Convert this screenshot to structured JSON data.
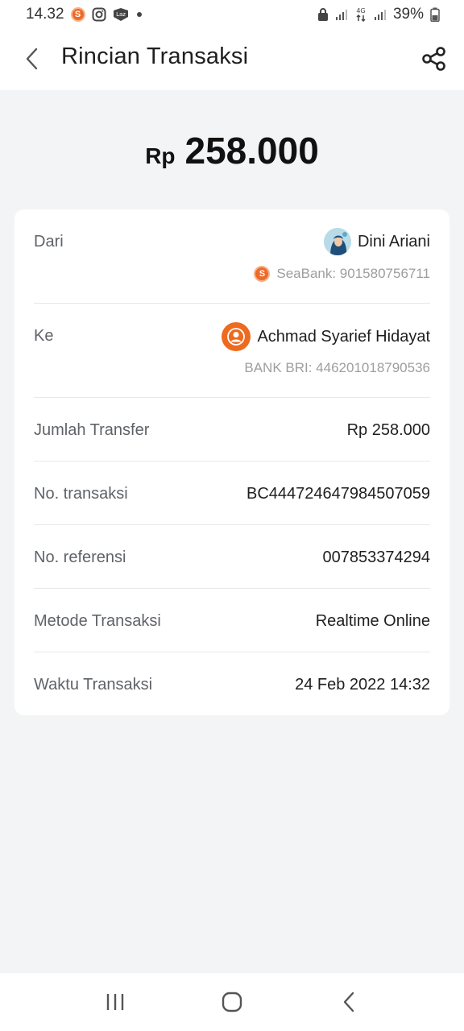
{
  "status_bar": {
    "time": "14.32",
    "battery": "39%",
    "network": "4G",
    "icons": [
      "seabank-icon",
      "instagram-icon",
      "lazada-icon",
      "dot-icon",
      "lock-icon",
      "signal-icon",
      "signal-4g-icon",
      "signal-icon",
      "battery-icon"
    ]
  },
  "header": {
    "title": "Rincian Transaksi",
    "back_icon": "chevron-left-icon",
    "share_icon": "share-icon"
  },
  "amount": {
    "currency": "Rp",
    "value": "258.000"
  },
  "details": {
    "from": {
      "label": "Dari",
      "name": "Dini Ariani",
      "account": "SeaBank: 901580756711",
      "avatar": "user-photo-avatar",
      "bank_icon": "seabank-icon"
    },
    "to": {
      "label": "Ke",
      "name": "Achmad Syarief Hidayat",
      "account": "BANK BRI: 446201018790536",
      "avatar": "default-user-avatar"
    },
    "rows": [
      {
        "label": "Jumlah Transfer",
        "value": "Rp 258.000"
      },
      {
        "label": "No. transaksi",
        "value": "BC444724647984507059"
      },
      {
        "label": "No. referensi",
        "value": "007853374294"
      },
      {
        "label": "Metode Transaksi",
        "value": "Realtime Online"
      },
      {
        "label": "Waktu Transaksi",
        "value": "24 Feb 2022 14:32"
      }
    ]
  },
  "nav": {
    "icons": [
      "recent-apps-icon",
      "home-icon",
      "back-icon"
    ]
  },
  "colors": {
    "background": "#f3f4f6",
    "card": "#ffffff",
    "accent": "#ee6a1f",
    "label": "#5f6368",
    "muted": "#9e9e9e"
  }
}
